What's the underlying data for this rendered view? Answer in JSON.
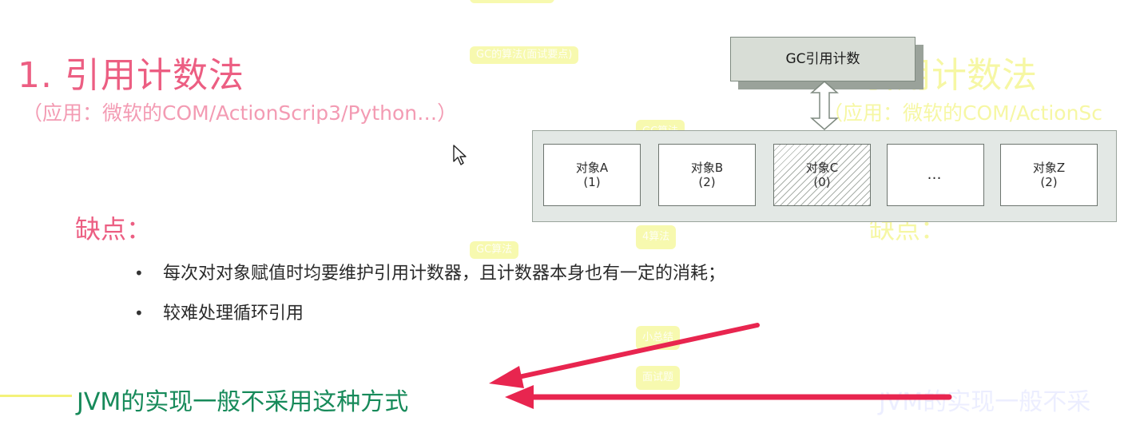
{
  "slide": {
    "title": "1. 引用计数法",
    "subtitle": "（应用：微软的COM/ActionScrip3/Python…）",
    "cons_title": "缺点：",
    "bullets": [
      "每次对对象赋值时均要维护引用计数器，且计数器本身也有一定的消耗；",
      "较难处理循环引用"
    ],
    "bullet_glyph": "•",
    "conclusion": "JVM的实现一般不采用这种方式"
  },
  "diagram": {
    "gc_label": "GC引用计数",
    "objects": [
      {
        "name": "对象A",
        "count": "(1)"
      },
      {
        "name": "对象B",
        "count": "(2)"
      },
      {
        "name": "对象C",
        "count": "(0)"
      },
      {
        "name": "…",
        "count": ""
      },
      {
        "name": "对象Z",
        "count": "(2)"
      }
    ]
  },
  "overlays": {
    "ghost_title": "1. 引用计数法",
    "ghost_subtitle": "（应用：微软的COM/ActionSc",
    "ghost_cons": "缺点：",
    "ghost_conclusion": "JVM的实现一般不采",
    "pill_1": "GC的算法(面试要点)",
    "pill_2": "GC算法",
    "pill_3": "4算法",
    "pill_4": "GC算法",
    "pill_5": "小总结",
    "pill_6": "面试题"
  },
  "colors": {
    "title_pink": "#ec5e82",
    "subtitle_pink": "#f39bb3",
    "conclusion_green": "#178a5a",
    "arrow_red": "#e8254f",
    "ghost_yellow": "#eef05a"
  },
  "icons": {
    "cursor": "mouse-pointer-icon",
    "arrow": "double-arrow-icon"
  }
}
